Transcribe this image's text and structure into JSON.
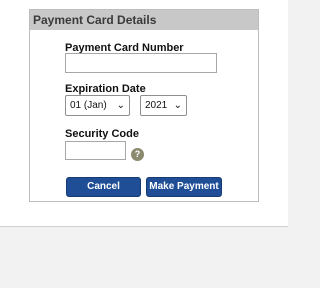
{
  "panel": {
    "title": "Payment Card Details"
  },
  "card_number": {
    "label": "Payment Card Number",
    "value": ""
  },
  "expiration": {
    "label": "Expiration Date",
    "month_selected": "01 (Jan)",
    "year_selected": "2021"
  },
  "security_code": {
    "label": "Security Code",
    "value": "",
    "help_glyph": "?"
  },
  "buttons": {
    "cancel": "Cancel",
    "make_payment": "Make Payment"
  },
  "icons": {
    "chevron": "chevron-down-icon",
    "help": "help-icon"
  }
}
